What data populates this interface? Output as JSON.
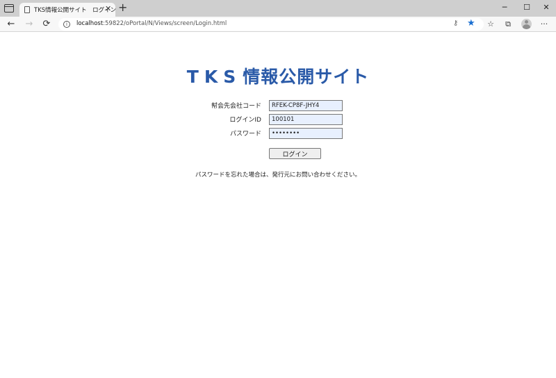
{
  "browser": {
    "tab": {
      "title": "TKS情報公開サイト　ログイン",
      "close": "✕"
    },
    "new_tab": "+",
    "window": {
      "minimize": "─",
      "maximize": "☐",
      "close": "✕"
    },
    "nav": {
      "back": "←",
      "forward": "→",
      "reload": "⟳"
    },
    "url": {
      "host": "localhost",
      "rest": ":59822/oPortal/N/Views/screen/Login.html"
    },
    "icons": {
      "info": "i",
      "key": "⚷",
      "star": "★",
      "favorites": "☆",
      "collections": "⧉",
      "more": "···"
    }
  },
  "page": {
    "title_prefix": "TKS",
    "title_suffix": "情報公開サイト",
    "title_color": "#2a5aa8",
    "form": {
      "company_code": {
        "label": "幇会先会社コード",
        "value": "RFEK-CP8F-JHY4"
      },
      "login_id": {
        "label": "ログインID",
        "value": "100101"
      },
      "password": {
        "label": "パスワード",
        "value": "password"
      }
    },
    "login_button": "ログイン",
    "help_text": "パスワードを忘れた場合は、発行元にお問い合わせください。"
  }
}
